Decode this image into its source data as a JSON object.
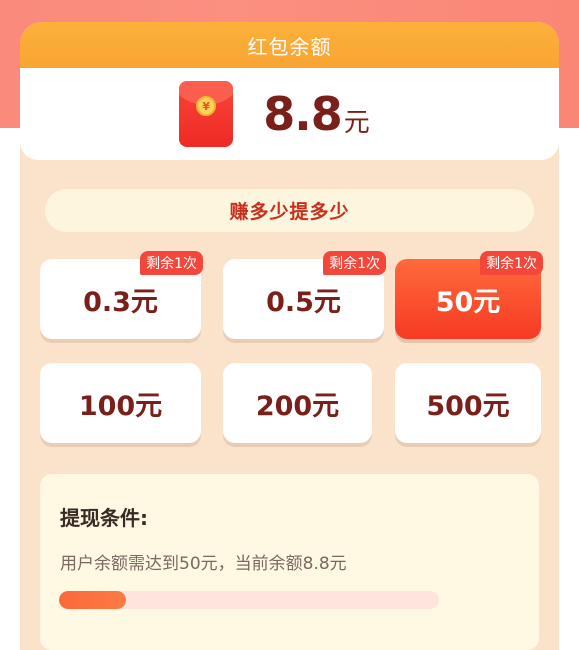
{
  "header": {
    "title": "红包余额"
  },
  "balance": {
    "amount": "8.8",
    "unit": "元",
    "icon": "red-envelope-icon",
    "coin_symbol": "¥"
  },
  "slogan": "赚多少提多少",
  "options": [
    {
      "label": "0.3元",
      "tag": "剩余1次",
      "selected": false
    },
    {
      "label": "0.5元",
      "tag": "剩余1次",
      "selected": false
    },
    {
      "label": "50元",
      "tag": "剩余1次",
      "selected": true
    },
    {
      "label": "100元",
      "tag": "",
      "selected": false
    },
    {
      "label": "200元",
      "tag": "",
      "selected": false
    },
    {
      "label": "500元",
      "tag": "",
      "selected": false
    }
  ],
  "condition": {
    "title": "提现条件:",
    "text": "用户余额需达到50元，当前余额8.8元",
    "progress": 0.176
  },
  "colors": {
    "accent": "#f63a24",
    "header_bg": "#fcb13a",
    "card_bg": "#fbe3cb",
    "amount_text": "#7a1f1a",
    "progress_fill": "#fb6a3a"
  }
}
